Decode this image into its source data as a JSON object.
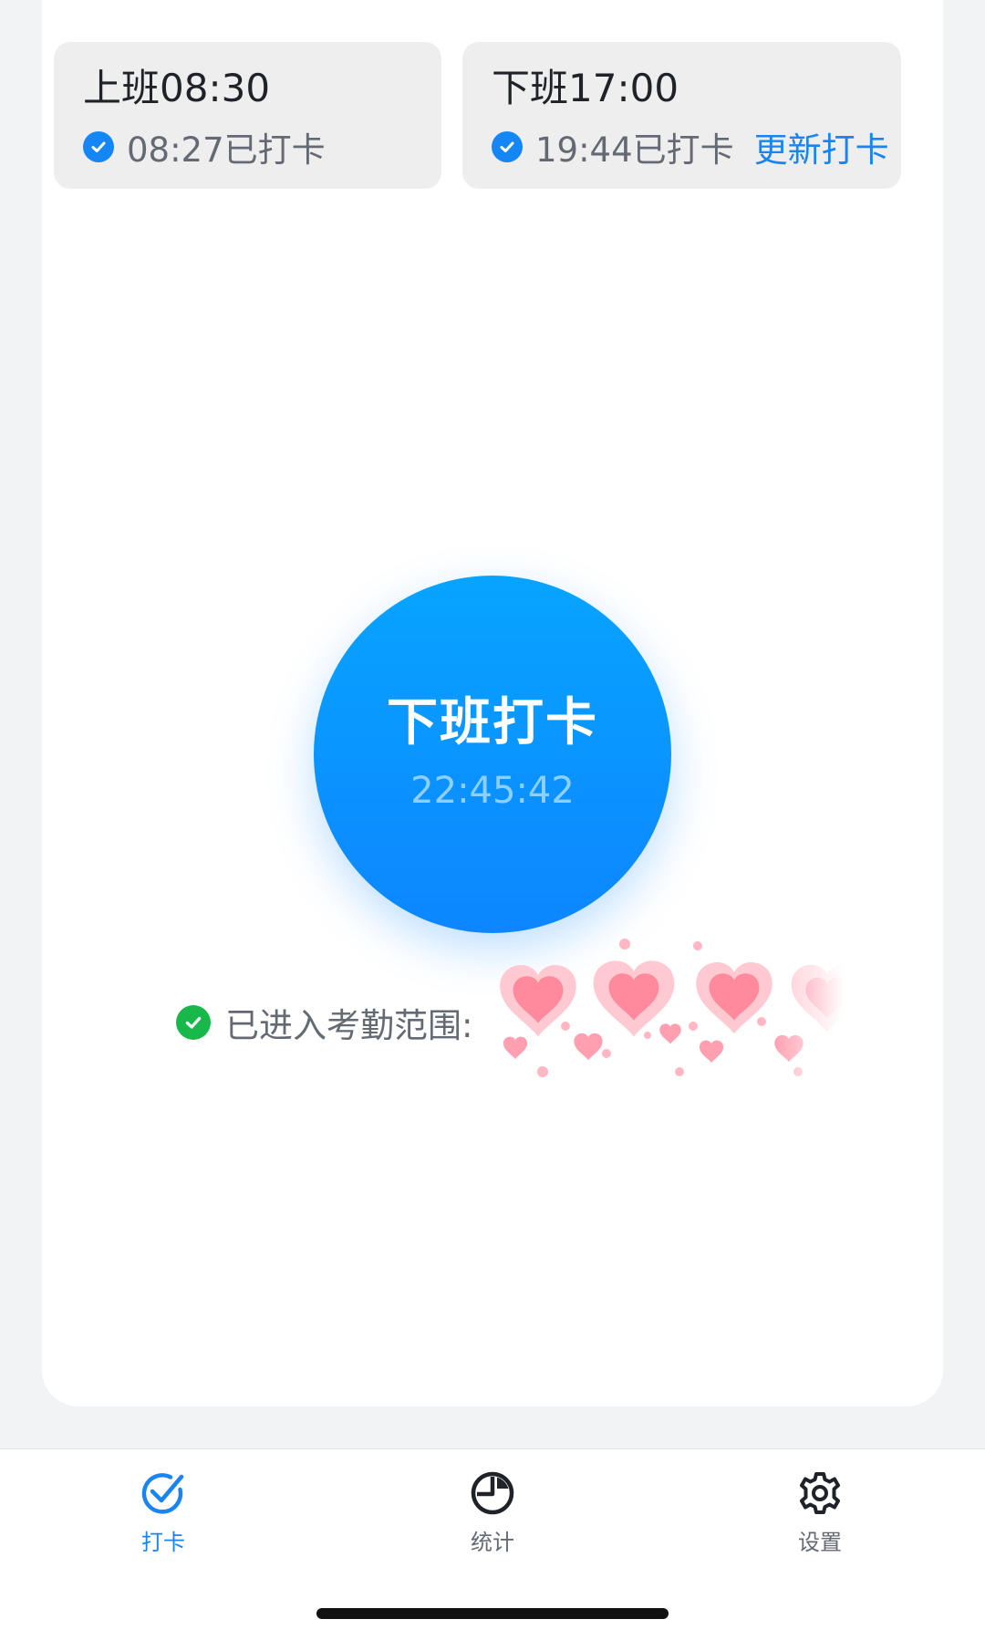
{
  "shifts": {
    "on_duty": {
      "title": "上班08:30",
      "status": "08:27已打卡"
    },
    "off_duty": {
      "title": "下班17:00",
      "status": "19:44已打卡",
      "action": "更新打卡"
    }
  },
  "punch_button": {
    "label": "下班打卡",
    "time": "22:45:42"
  },
  "attendance_range": {
    "text": "已进入考勤范围:"
  },
  "tabbar": {
    "items": [
      {
        "label": "打卡",
        "icon": "check-badge-icon",
        "active": true
      },
      {
        "label": "统计",
        "icon": "pie-chart-icon",
        "active": false
      },
      {
        "label": "设置",
        "icon": "gear-icon",
        "active": false
      }
    ]
  },
  "colors": {
    "accent": "#1a84f0",
    "button_top": "#07a4ff",
    "button_bottom": "#0d86ff",
    "success": "#19b84a"
  }
}
